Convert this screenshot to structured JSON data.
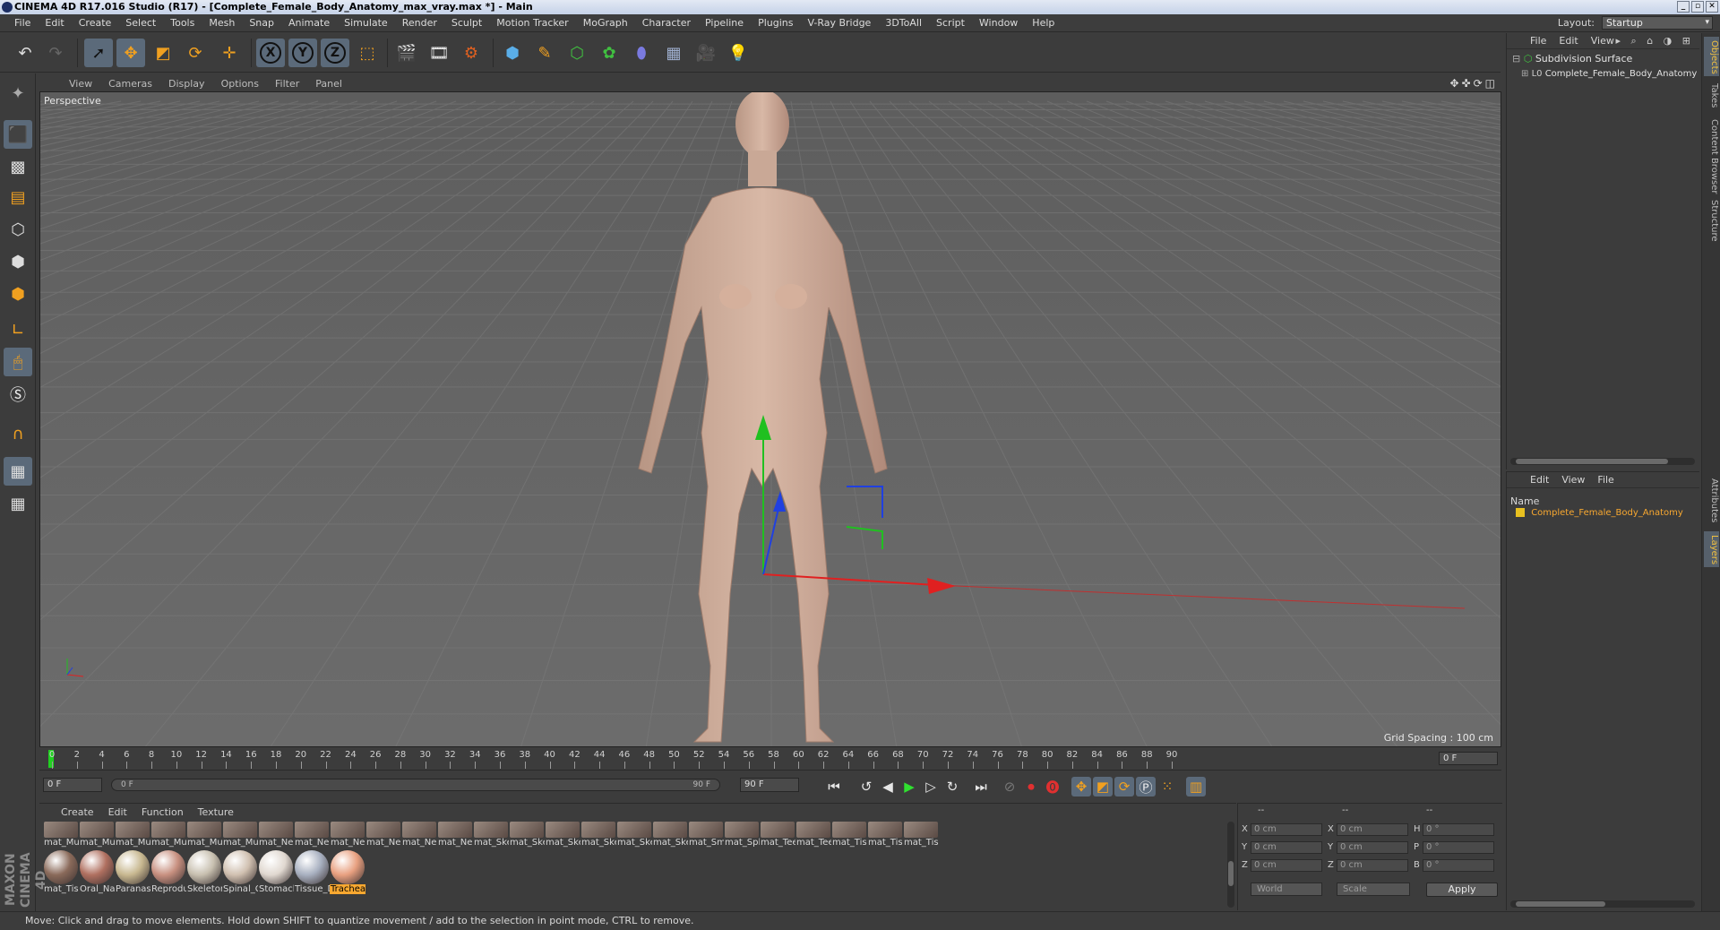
{
  "window": {
    "title": "CINEMA 4D R17.016 Studio (R17) - [Complete_Female_Body_Anatomy_max_vray.max *] - Main"
  },
  "menu": [
    "File",
    "Edit",
    "Create",
    "Select",
    "Tools",
    "Mesh",
    "Snap",
    "Animate",
    "Simulate",
    "Render",
    "Sculpt",
    "Motion Tracker",
    "MoGraph",
    "Character",
    "Pipeline",
    "Plugins",
    "V-Ray Bridge",
    "3DToAll",
    "Script",
    "Window",
    "Help"
  ],
  "layout": {
    "label": "Layout:",
    "value": "Startup"
  },
  "toolbar": {
    "icons": [
      "undo-icon",
      "redo-icon",
      "live-selection-icon",
      "move-icon",
      "scale-icon",
      "rotate-icon",
      "last-tool-icon",
      "lock-x-icon",
      "lock-y-icon",
      "lock-z-icon",
      "coordinate-system-icon",
      "render-view-icon",
      "render-to-picture-viewer-icon",
      "edit-render-settings-icon",
      "cube-icon",
      "pen-spline-icon",
      "subdivision-icon",
      "array-icon",
      "deformer-icon",
      "floor-icon",
      "camera-icon",
      "light-icon"
    ],
    "axis_labels": {
      "x": "X",
      "y": "Y",
      "z": "Z"
    }
  },
  "left_tools": [
    "make-editable-icon",
    "texture-mode-icon",
    "workplane-icon",
    "points-mode-icon",
    "edges-mode-icon",
    "polygons-mode-icon",
    "axis-mode-icon",
    "tweak-icon",
    "solo-icon",
    "magnet-icon",
    "snap-grid-icon",
    "snap-settings-icon"
  ],
  "viewport": {
    "menu": [
      "View",
      "Cameras",
      "Display",
      "Options",
      "Filter",
      "Panel"
    ],
    "nav_icons": "✥✜⟳◫",
    "camera_label": "Perspective",
    "grid_spacing": "Grid Spacing : 100 cm"
  },
  "timeline": {
    "ticks": [
      "0",
      "2",
      "4",
      "6",
      "8",
      "10",
      "12",
      "14",
      "16",
      "18",
      "20",
      "22",
      "24",
      "26",
      "28",
      "30",
      "32",
      "34",
      "36",
      "38",
      "40",
      "42",
      "44",
      "46",
      "48",
      "50",
      "52",
      "54",
      "56",
      "58",
      "60",
      "62",
      "64",
      "66",
      "68",
      "70",
      "72",
      "74",
      "76",
      "78",
      "80",
      "82",
      "84",
      "86",
      "88",
      "90"
    ],
    "current_frame": "0 F",
    "start_field": "0 F",
    "range_start": "0 F",
    "range_end": "90 F",
    "end_field": "90 F"
  },
  "material_manager": {
    "menu": [
      "Create",
      "Edit",
      "Function",
      "Texture"
    ],
    "row1": [
      "mat_Mus",
      "mat_Mus",
      "mat_Mus",
      "mat_Mus",
      "mat_Mus",
      "mat_Mus",
      "mat_Ner",
      "mat_Ner",
      "mat_Ner",
      "mat_Ner",
      "mat_Ner",
      "mat_Ner",
      "mat_Ske",
      "mat_Ske",
      "mat_Ske",
      "mat_Ske",
      "mat_Ske",
      "mat_Ske",
      "mat_Sma",
      "mat_Sple",
      "mat_Tee",
      "mat_Tee",
      "mat_Tiss",
      "mat_Tiss",
      "mat_Tiss"
    ],
    "row2": [
      "mat_Tiss",
      "Oral_Nas",
      "Paranasa",
      "Reprodu",
      "Skeleton",
      "Spinal_C",
      "Stomach",
      "Tissue_D",
      "Trachea"
    ],
    "selected": "Trachea",
    "brand": "MAXON CINEMA 4D"
  },
  "coordinates": {
    "headers": [
      "--",
      "--",
      "--"
    ],
    "rows": [
      {
        "a": "X",
        "av": "0 cm",
        "b": "X",
        "bv": "0 cm",
        "c": "H",
        "cv": "0 °"
      },
      {
        "a": "Y",
        "av": "0 cm",
        "b": "Y",
        "bv": "0 cm",
        "c": "P",
        "cv": "0 °"
      },
      {
        "a": "Z",
        "av": "0 cm",
        "b": "Z",
        "bv": "0 cm",
        "c": "B",
        "cv": "0 °"
      }
    ],
    "space": "World",
    "mode": "Scale",
    "apply": "Apply"
  },
  "status": "Move: Click and drag to move elements. Hold down SHIFT to quantize movement / add to the selection in point mode, CTRL to remove.",
  "object_manager": {
    "menu": [
      "File",
      "Edit",
      "View"
    ],
    "objects": [
      {
        "name": "Subdivision Surface"
      },
      {
        "name": "Complete_Female_Body_Anatomy"
      }
    ]
  },
  "layer_manager": {
    "menu": [
      "File",
      "Edit",
      "View"
    ],
    "header": "Name",
    "layers": [
      {
        "name": "Complete_Female_Body_Anatomy",
        "color": "#e8c020"
      }
    ]
  },
  "right_tabs_top": [
    "Objects",
    "Takes",
    "Content Browser",
    "Structure"
  ],
  "right_tabs_bottom": [
    "Attributes",
    "Layers"
  ],
  "colors": {
    "accent": "#f8a830",
    "x_axis": "#e02020",
    "y_axis": "#20c020",
    "z_axis": "#2040e0"
  }
}
